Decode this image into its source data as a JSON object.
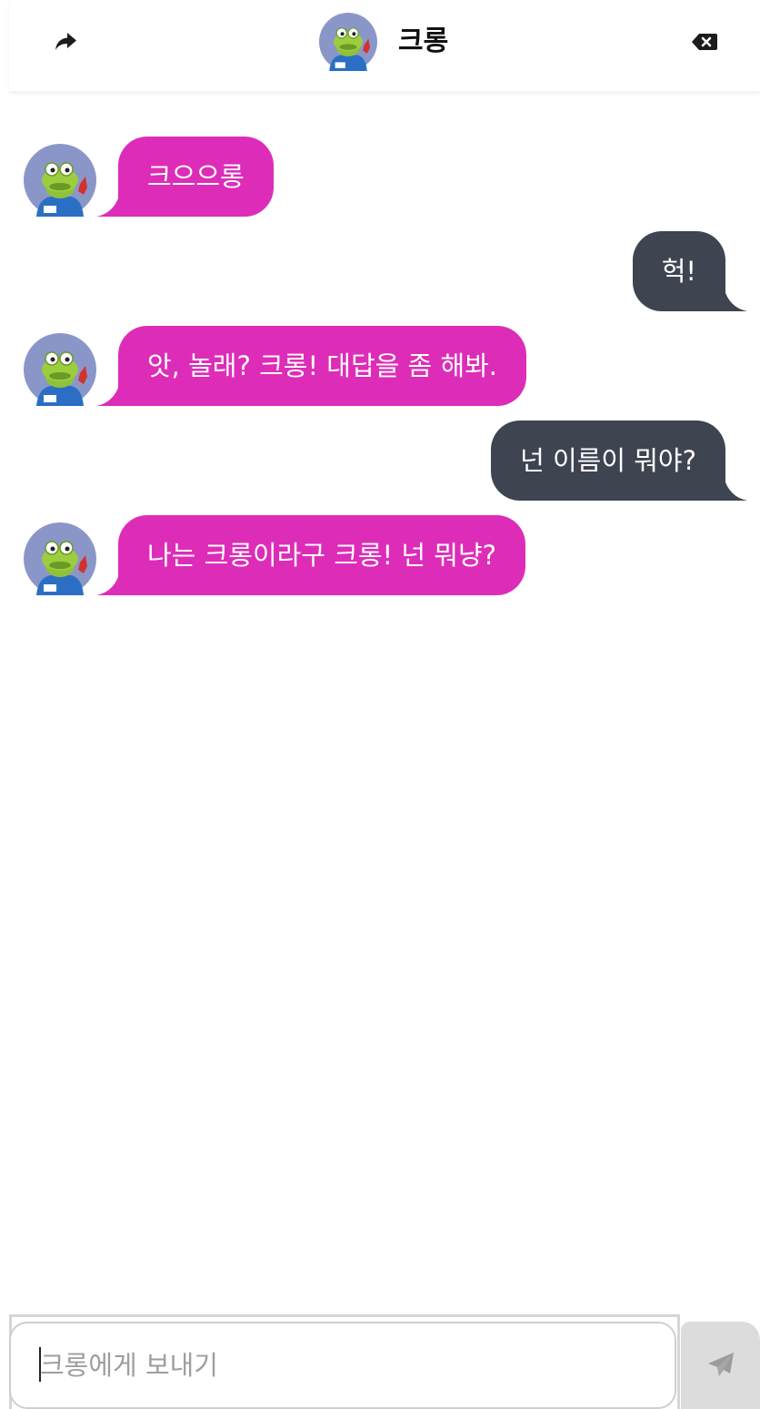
{
  "header": {
    "title": "크롱",
    "share_icon": "share-icon",
    "close_icon": "backspace-close-icon"
  },
  "colors": {
    "bot_bubble": "#dd2db8",
    "user_bubble": "#3f4451",
    "avatar_bg": "#8b96c8"
  },
  "messages": [
    {
      "sender": "bot",
      "text": "크으으롱"
    },
    {
      "sender": "user",
      "text": "헉!"
    },
    {
      "sender": "bot",
      "text": "앗, 놀래? 크롱! 대답을 좀 해봐."
    },
    {
      "sender": "user",
      "text": "넌 이름이 뭐야?"
    },
    {
      "sender": "bot",
      "text": "나는 크롱이라구 크롱! 넌 뭐냥?"
    }
  ],
  "composer": {
    "placeholder": "크롱에게 보내기",
    "send_icon": "paper-plane-icon"
  }
}
